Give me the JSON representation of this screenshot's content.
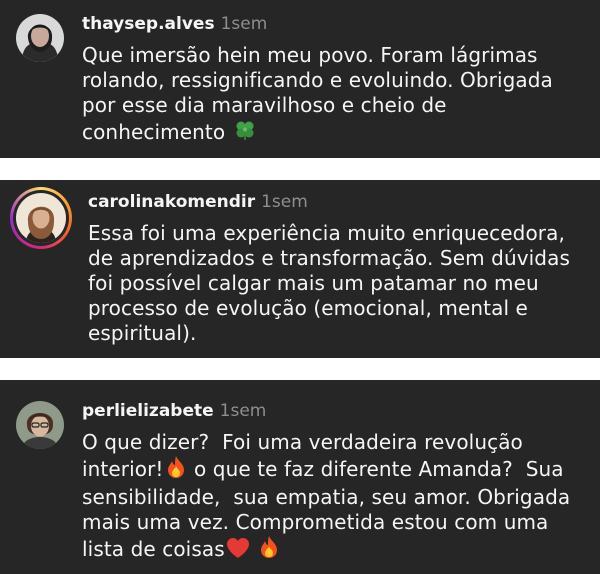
{
  "comments": [
    {
      "username": "thaysep.alves",
      "time": "1sem",
      "lines": [
        "Que imersão hein meu povo. Foram lágrimas",
        "rolando, ressignificando e evoluindo. Obrigada",
        "por esse dia maravilhoso e cheio de",
        "conhecimento "
      ],
      "emojis": [
        "four-leaf-clover"
      ]
    },
    {
      "username": "carolinakomendir",
      "time": "1sem",
      "lines": [
        "Essa foi uma experiência muito enriquecedora,",
        "de aprendizados e transformação. Sem dúvidas",
        "foi possível calgar mais um patamar no meu",
        "processo de evolução (emocional, mental e",
        "espiritual)."
      ]
    },
    {
      "username": "perlielizabete",
      "time": "1sem",
      "lines": [
        "O que dizer?  Foi uma verdadeira revolução",
        "interior!",
        " o que te faz diferente Amanda?  Sua",
        "sensibilidade,  sua empatia, seu amor. Obrigada",
        "mais uma vez. Comprometida estou com uma",
        "lista de coisas"
      ],
      "emojis": [
        "fire",
        "red-heart",
        "fire"
      ]
    }
  ],
  "colors": {
    "card_background": "#262626",
    "separator": "#ffffff",
    "text": "#f5f5f5",
    "timestamp": "#8e8e8e",
    "story_ring": [
      "#feda75",
      "#fa7e1e",
      "#d62976",
      "#962fbf"
    ]
  }
}
